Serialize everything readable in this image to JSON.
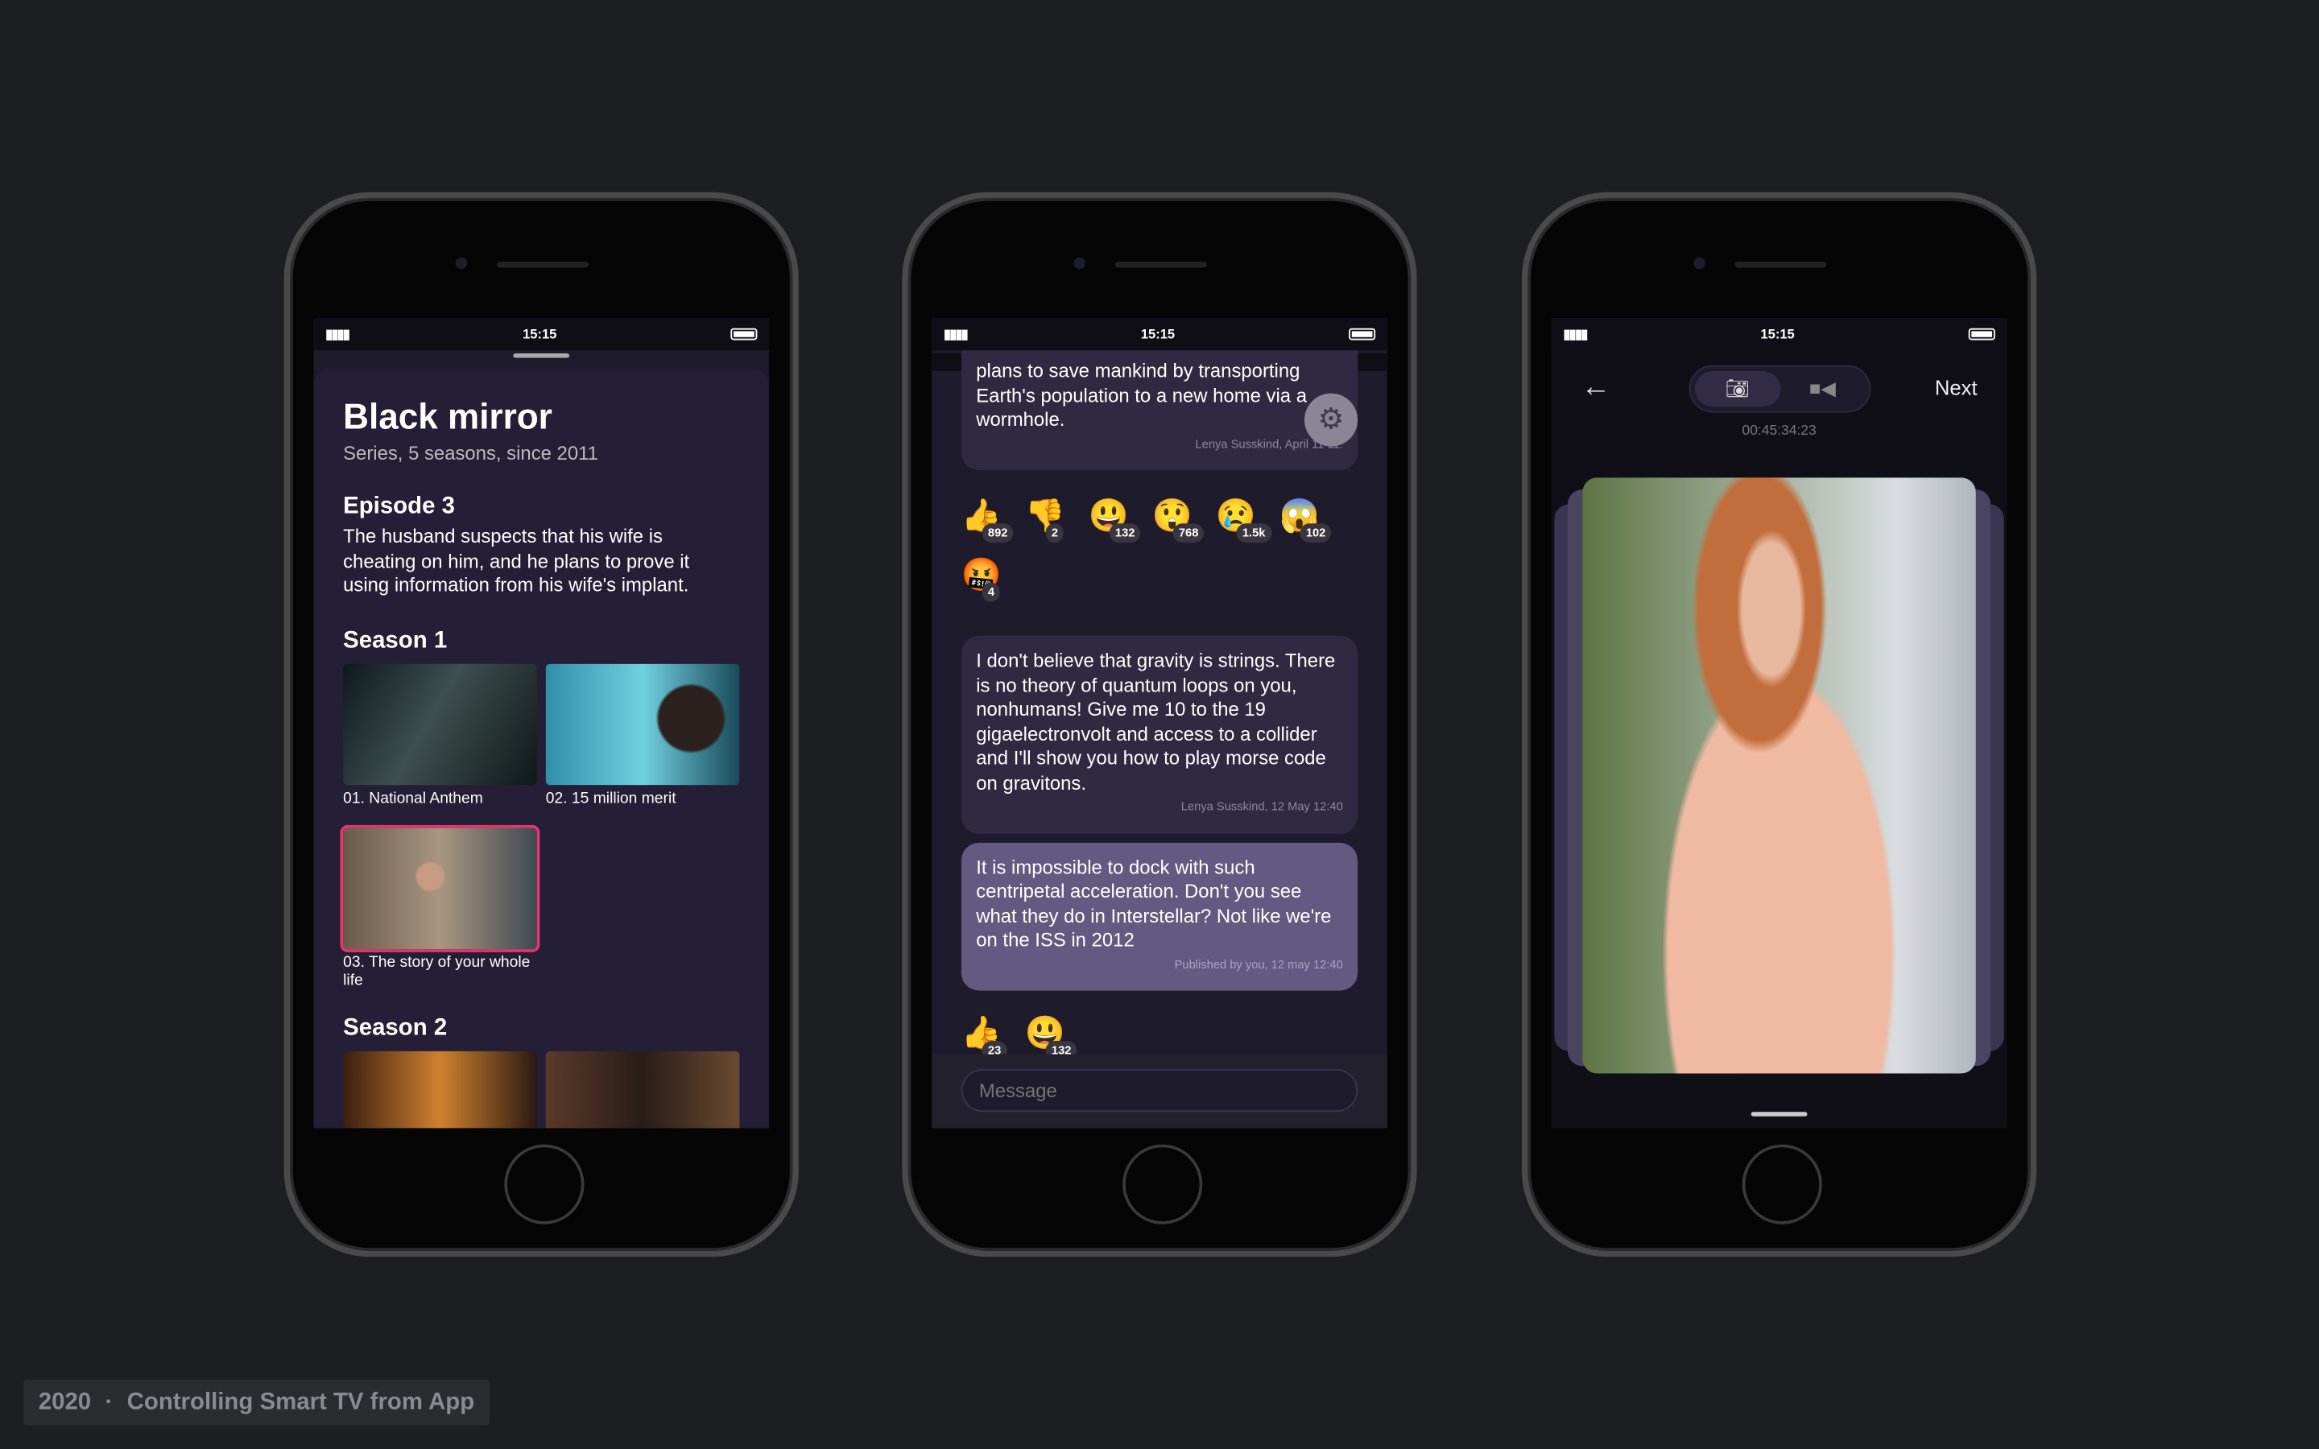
{
  "status": {
    "time": "15:15"
  },
  "series": {
    "title": "Black mirror",
    "subtitle": "Series, 5 seasons, since 2011",
    "episode_heading": "Episode 3",
    "episode_text": "The husband suspects that his wife is cheating on him, and he plans to prove it using information from his wife's implant.",
    "seasons": [
      {
        "label": "Season 1",
        "episodes": [
          {
            "title": "01. National Anthem"
          },
          {
            "title": "02. 15 million merit"
          },
          {
            "title": "03. The story of your whole life",
            "selected": true
          }
        ]
      },
      {
        "label": "Season 2",
        "episodes": [
          {
            "title": ""
          },
          {
            "title": ""
          }
        ]
      }
    ]
  },
  "chat": {
    "messages": [
      {
        "text": "plans to save mankind by transporting Earth's population to a new home via a wormhole.",
        "meta": "Lenya Susskind, April 11 11:",
        "reactions": [
          {
            "emoji": "👍",
            "count": "892"
          },
          {
            "emoji": "👎",
            "count": "2"
          },
          {
            "emoji": "😃",
            "count": "132"
          },
          {
            "emoji": "😲",
            "count": "768"
          },
          {
            "emoji": "😢",
            "count": "1.5k"
          },
          {
            "emoji": "😱",
            "count": "102"
          },
          {
            "emoji": "🤬",
            "count": "4"
          }
        ]
      },
      {
        "text": "I don't believe that gravity is strings. There is no theory of quantum loops on you, nonhumans! Give me 10 to the 19 gigaelectronvolt and access to a collider and I'll show you how to play morse code on gravitons.",
        "meta": "Lenya Susskind, 12 May 12:40"
      },
      {
        "text": "It is impossible to dock with such centripetal acceleration. Don't you see what they do in Interstellar? Not like we're on the ISS in 2012",
        "meta": "Published by you, 12 may 12:40",
        "reactions": [
          {
            "emoji": "👍",
            "count": "23"
          },
          {
            "emoji": "😃",
            "count": "132"
          }
        ]
      }
    ],
    "input_placeholder": "Message"
  },
  "capture": {
    "next_label": "Next",
    "timecode": "00:45:34:23",
    "mode": "photo"
  },
  "caption": {
    "year": "2020",
    "sep": "·",
    "title": "Controlling Smart TV from App"
  },
  "colors": {
    "background": "#1d1e22",
    "card": "#241e36",
    "own_bubble": "#625a80",
    "highlight": "#e0386a"
  }
}
